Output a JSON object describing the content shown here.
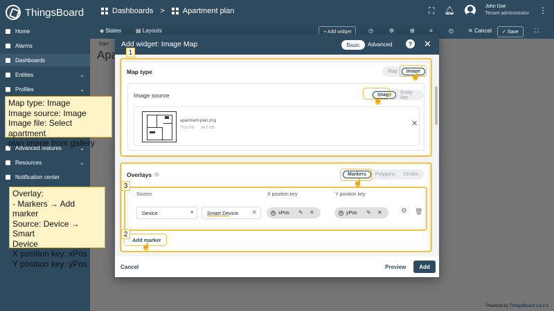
{
  "app": {
    "name": "ThingsBoard"
  },
  "breadcrumb": {
    "item1": "Dashboards",
    "separator": ">",
    "item2": "Apartment plan"
  },
  "user": {
    "name": "John Doe",
    "role": "Tenant administrator"
  },
  "sidebar": {
    "items": [
      {
        "label": "Home",
        "chevron": ""
      },
      {
        "label": "Alarms",
        "chevron": ""
      },
      {
        "label": "Dashboards",
        "chevron": ""
      },
      {
        "label": "Entities",
        "chevron": "⌄"
      },
      {
        "label": "Profiles",
        "chevron": "⌄"
      },
      {
        "label": "Advanced features",
        "chevron": "⌄"
      },
      {
        "label": "Resources",
        "chevron": "⌄"
      },
      {
        "label": "Notification center",
        "chevron": ""
      }
    ]
  },
  "dash_toolbar": {
    "states": "States",
    "layouts": "Layouts",
    "add_widget": "+ Add widget",
    "cancel": "Cancel",
    "save": "Save"
  },
  "dashboard": {
    "title_small": "Title*",
    "title": "Apa"
  },
  "dialog": {
    "title": "Add widget:  Image Map",
    "mode_basic": "Basic",
    "mode_advanced": "Advanced",
    "map_type": {
      "title": "Map type",
      "opt_map": "Map",
      "opt_image": "Image"
    },
    "image_source": {
      "title": "Image source",
      "opt_image": "Image",
      "opt_entity_key": "Entity key"
    },
    "image_file": {
      "name": "apartment-plan.png",
      "dims": "731x702",
      "size": "34.5 KB"
    },
    "overlays": {
      "title": "Overlays",
      "tab_markers": "Markers",
      "tab_polygons": "Polygons",
      "tab_circles": "Circles",
      "col_source": "Source",
      "col_x": "X position key",
      "col_y": "Y position key",
      "source_type": "Device",
      "source_value": "Smart Device",
      "x_key": "xPos",
      "y_key": "yPos",
      "add_marker": "Add marker"
    },
    "footer": {
      "cancel": "Cancel",
      "preview": "Preview",
      "add": "Add"
    }
  },
  "annotations": {
    "callout1": [
      "Map type: Image",
      "Image source: Image",
      "Image file: Select apartment",
      "plan image from gallery"
    ],
    "callout2": [
      "Overlay:",
      "- Markers → Add marker",
      "Source: Device → Smart",
      "Device",
      "X position key: xPos",
      "Y position key: yPos"
    ],
    "badge1": "1",
    "badge2": "2",
    "badge3": "3"
  },
  "footer": {
    "powered_prefix": "Powered by ",
    "powered_brand": "ThingsBoard v.4.2.1"
  },
  "colors": {
    "primary": "#2d4a5e",
    "highlight": "#f6c244",
    "callout_bg": "#fff4c8"
  }
}
